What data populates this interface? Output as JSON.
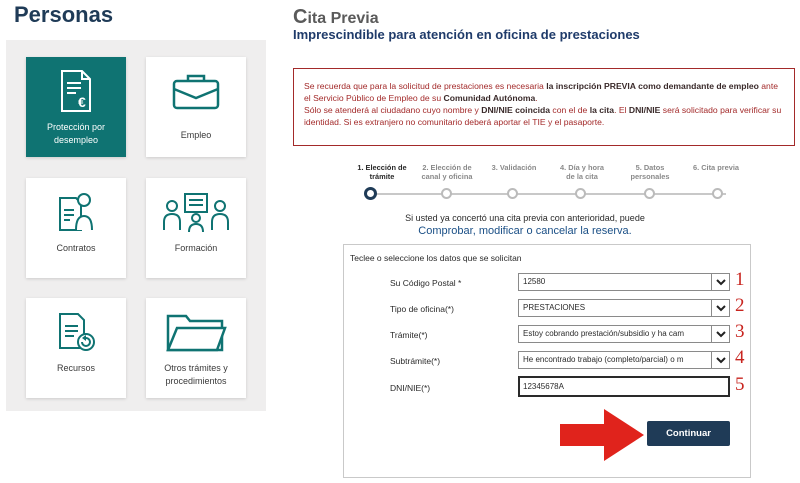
{
  "left": {
    "title": "Personas",
    "cards": [
      {
        "label": "Protección por desempleo",
        "icon": "document-euro-icon",
        "active": true
      },
      {
        "label": "Empleo",
        "icon": "briefcase-icon",
        "active": false
      },
      {
        "label": "Contratos",
        "icon": "contract-person-icon",
        "active": false
      },
      {
        "label": "Formación",
        "icon": "training-people-icon",
        "active": false
      },
      {
        "label": "Recursos",
        "icon": "document-return-icon",
        "active": false
      },
      {
        "label": "Otros trámites y procedimientos",
        "icon": "folder-icon",
        "active": false
      }
    ]
  },
  "header": {
    "title_cap": "C",
    "title_rest": "ita Previa",
    "subtitle": "Imprescindible para atención en oficina de prestaciones"
  },
  "notice": {
    "p1": "Se recuerda que para la solicitud de prestaciones es necesaria",
    "p1_bold": "la inscripción PREVIA como demandante de empleo",
    "p1b": "ante el Servicio Público de Empleo de su",
    "p1b_bold": "Comunidad Autónoma",
    "p2": "Sólo se atenderá al ciudadano cuyo nombre y",
    "p2_bold": "DNI/NIE coincida",
    "p2b": "con el de",
    "p2b_bold": "la cita",
    "p2c": ". El",
    "p2c_bold": "DNI/NIE",
    "p2d": "será solicitado para verificar su identidad. Si es extranjero no comunitario deberá aportar el TIE y el pasaporte."
  },
  "steps": [
    {
      "l1": "1. Elección de",
      "l2": "trámite",
      "active": true
    },
    {
      "l1": "2. Elección de",
      "l2": "canal y oficina",
      "active": false
    },
    {
      "l1": "3. Validación",
      "l2": "",
      "active": false
    },
    {
      "l1": "4. Día y hora",
      "l2": "de la cita",
      "active": false
    },
    {
      "l1": "5. Datos",
      "l2": "personales",
      "active": false
    },
    {
      "l1": "6. Cita previa",
      "l2": "",
      "active": false
    }
  ],
  "previous": {
    "text": "Si usted ya concertó una cita previa con anterioridad, puede",
    "link1": "Comprobar",
    "sep1": ", ",
    "link2": "modificar",
    "sep2": " o ",
    "link3": "cancelar la reserva",
    "end": "."
  },
  "form": {
    "legend": "Teclee o seleccione los datos que se solicitan",
    "fields": [
      {
        "label": "Su Código Postal *",
        "value": "12580",
        "num": "1"
      },
      {
        "label": "Tipo de oficina(*)",
        "value": "PRESTACIONES",
        "num": "2"
      },
      {
        "label": "Trámite(*)",
        "value": "Estoy cobrando prestación/subsidio y ha cam",
        "num": "3"
      },
      {
        "label": "Subtrámite(*)",
        "value": "He encontrado trabajo (completo/parcial) o m",
        "num": "4"
      },
      {
        "label": "DNI/NIE(*)",
        "value": "12345678A",
        "num": "5"
      }
    ],
    "submit": "Continuar"
  },
  "colors": {
    "teal": "#0f7372",
    "navy": "#1f3b57",
    "red": "#c8251f",
    "notice_border": "#a32a2a"
  }
}
